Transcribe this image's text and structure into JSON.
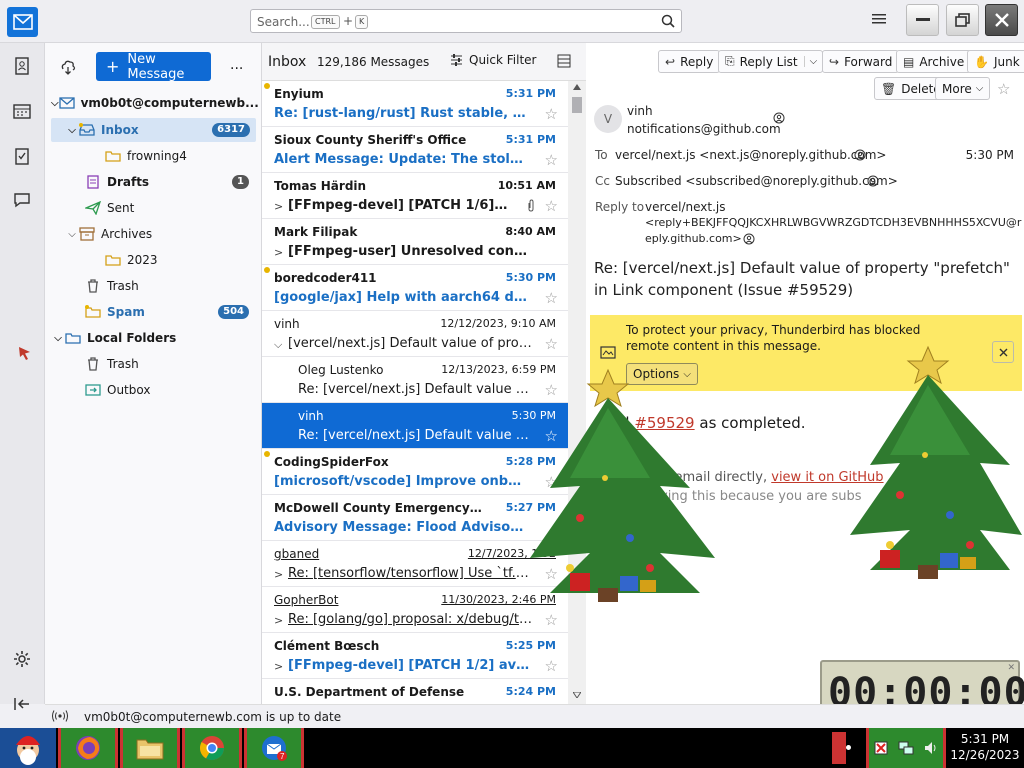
{
  "search": {
    "placeholder": "Search...",
    "key1": "CTRL",
    "plus": "+",
    "key2": "K"
  },
  "folder_pane": {
    "new_message": "New Message",
    "more": "...",
    "account": "vm0b0t@computernewb...",
    "items": [
      {
        "label": "Inbox",
        "badge": "6317"
      },
      {
        "label": "frowning4"
      },
      {
        "label": "Drafts",
        "badge": "1"
      },
      {
        "label": "Sent"
      },
      {
        "label": "Archives"
      },
      {
        "label": "2023"
      },
      {
        "label": "Trash"
      },
      {
        "label": "Spam",
        "badge": "504"
      },
      {
        "label": "Local Folders"
      },
      {
        "label": "Trash"
      },
      {
        "label": "Outbox"
      }
    ]
  },
  "list": {
    "title": "Inbox",
    "count": "129,186 Messages",
    "quick_filter": "Quick Filter",
    "messages": [
      {
        "from": "Enyium",
        "date": "5:31 PM",
        "subject": "Re: [rust-lang/rust] Rust stable, fatal ru..."
      },
      {
        "from": "Sioux County Sheriff's Office",
        "date": "5:31 PM",
        "subject": "Alert Message: Update: The stolen gree..."
      },
      {
        "from": "Tomas Härdin",
        "date": "10:51 AM",
        "subject": "[FFmpeg-devel] [PATCH 1/6] doc/..."
      },
      {
        "from": "Mark Filipak",
        "date": "8:40 AM",
        "subject": "[FFmpeg-user] Unresolved concatena..."
      },
      {
        "from": "boredcoder411",
        "date": "5:30 PM",
        "subject": "[google/jax] Help with aarch64 depend..."
      },
      {
        "from": "vinh",
        "date": "12/12/2023, 9:10 AM",
        "subject": "[vercel/next.js] Default value of property..."
      },
      {
        "from": "Oleg Lustenko",
        "date": "12/13/2023, 6:59 PM",
        "subject": "Re: [vercel/next.js] Default value of pro..."
      },
      {
        "from": "vinh",
        "date": "5:30 PM",
        "subject": "Re: [vercel/next.js] Default value of pro..."
      },
      {
        "from": "CodingSpiderFox",
        "date": "5:28 PM",
        "subject": "[microsoft/vscode] Improve onboardin..."
      },
      {
        "from": "McDowell County Emergency Managem...",
        "date": "5:27 PM",
        "subject": "Advisory Message: Flood Advisory until..."
      },
      {
        "from": "gbaned",
        "date": "12/7/2023, 1:52",
        "subject": "Re: [tensorflow/tensorflow] Use `tf.Unpa..."
      },
      {
        "from": "GopherBot",
        "date": "11/30/2023, 2:46 PM",
        "subject": "Re: [golang/go] proposal: x/debug/trac..."
      },
      {
        "from": "Clément Bœsch",
        "date": "5:25 PM",
        "subject": "[FFmpeg-devel] [PATCH 1/2] avcodec..."
      },
      {
        "from": "U.S. Department of Defense",
        "date": "5:24 PM",
        "subject": ""
      }
    ]
  },
  "reader": {
    "toolbar": {
      "reply": "Reply",
      "reply_list": "Reply List",
      "forward": "Forward",
      "archive": "Archive",
      "junk": "Junk",
      "delete": "Delete",
      "more": "More"
    },
    "avatar_letter": "V",
    "sender_name": "vinh",
    "sender_email": "notifications@github.com",
    "to_label": "To",
    "to_value": "vercel/next.js <next.js@noreply.github.com>",
    "time": "5:30 PM",
    "cc_label": "Cc",
    "cc_value": "Subscribed <subscribed@noreply.github.com>",
    "replyto_label": "Reply to",
    "replyto_line1": "vercel/next.js",
    "replyto_line2": "<reply+BEKJFFQQJKCXHRLWBGVWRZGDTCDH3EVBNHHHS5XCVU@r",
    "replyto_line3": "eply.github.com>",
    "subject": "Re: [vercel/next.js] Default value of property \"prefetch\" in Link component (Issue #59529)",
    "privacy_text": "To protect your privacy, Thunderbird has blocked remote content in this message.",
    "options": "Options",
    "body_prefix": "d",
    "body_link": "#59529",
    "body_suffix": "as completed.",
    "reply_prefix": "is email directly,",
    "reply_link": "view it on GitHub",
    "footer": "ving this because you are subs"
  },
  "status": {
    "text": "vm0b0t@computernewb.com is up to date"
  },
  "timer": {
    "text": "00:00:00"
  },
  "clock": {
    "time": "5:31 PM",
    "date": "12/26/2023"
  },
  "colors": {
    "accent": "#0f6ad4",
    "unread": "#1a6fc4",
    "privacy": "#fde966"
  }
}
